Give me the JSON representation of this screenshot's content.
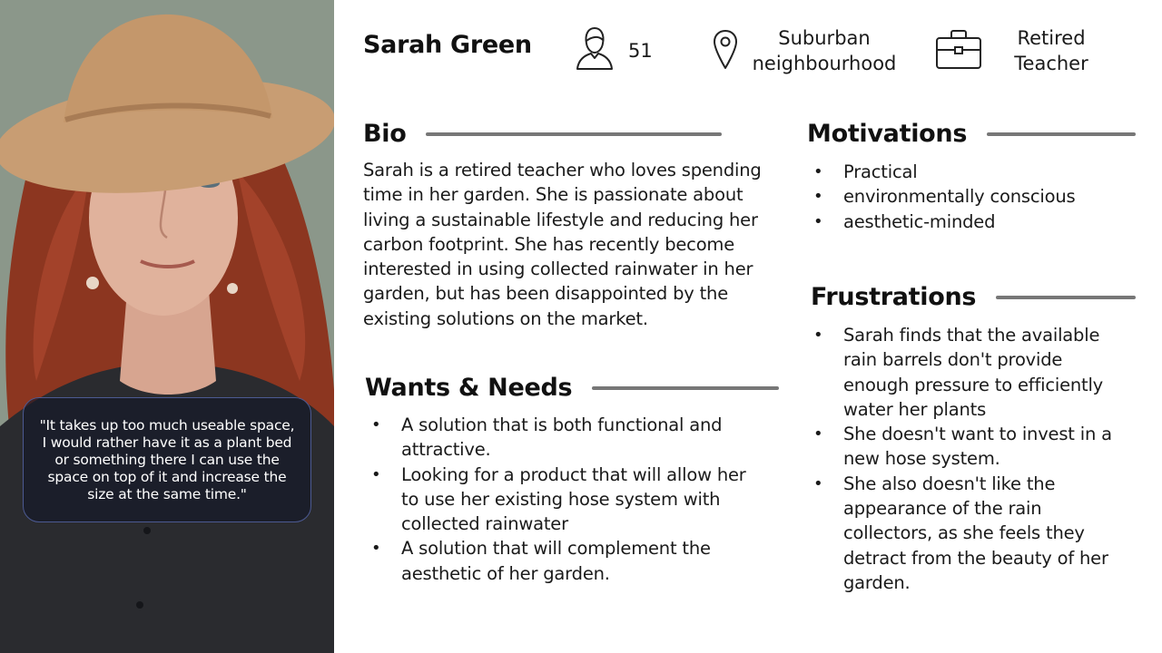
{
  "persona": {
    "name": "Sarah Green",
    "age": "51",
    "location": "Suburban neighbourhood",
    "occupation": "Retired Teacher"
  },
  "icons": {
    "age": "person-icon",
    "location": "map-pin-icon",
    "occupation": "briefcase-icon"
  },
  "photo": {
    "quote": "\"It takes up too much useable space, I would rather have it as a plant bed or something there I can use the space on top of it and increase the size at the same time.\""
  },
  "bio": {
    "heading": "Bio",
    "text": "Sarah is a retired teacher who loves spending time in her garden. She is passionate about living a sustainable lifestyle and reducing her carbon footprint. She has recently become interested in using collected rainwater in her garden, but has been disappointed by the existing solutions on the market."
  },
  "wants": {
    "heading": "Wants & Needs",
    "items": [
      "A solution that is both functional and attractive.",
      "Looking for a product that will allow her to use her existing hose system with collected rainwater",
      "A solution that will complement the aesthetic of her garden."
    ]
  },
  "motivations": {
    "heading": "Motivations",
    "items": [
      "Practical",
      "environmentally conscious",
      "aesthetic-minded"
    ]
  },
  "frustrations": {
    "heading": "Frustrations",
    "items": [
      "Sarah finds that the available rain barrels don't provide enough pressure to efficiently water her plants",
      "She doesn't want to invest in a new hose system.",
      "She also doesn't like the appearance of the rain collectors, as she feels they detract from the beauty of her garden."
    ]
  },
  "colors": {
    "rule": "#777777",
    "quote_border": "#4c5a92",
    "hat": "#c89d73",
    "hair": "#9a3a22"
  }
}
